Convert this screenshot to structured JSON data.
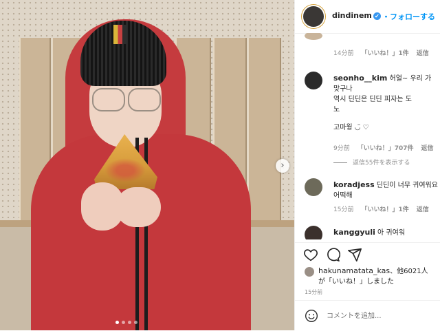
{
  "post": {
    "username": "dindinem",
    "verified_mark": "✔",
    "follow_label": "・フォローする"
  },
  "icons": [
    "verified-icon",
    "heart-icon",
    "comment-icon",
    "share-icon",
    "smile-icon",
    "next-arrow-icon"
  ],
  "comments": [
    {
      "user": "",
      "text": "",
      "time": "14分前",
      "likes": "「いいね！」1件",
      "reply": "返信"
    },
    {
      "user": "seonho__kim",
      "text": " 허얼~ 우리 가\n맞구나 \n역시 딘딘은 딘딘 피자는 도\n노",
      "time": "9分前",
      "likes": "「いいね！」707件",
      "reply": "返信"
    },
    {
      "user": "",
      "text": "고마웡 ◡̈ ♡",
      "time": "",
      "likes": "",
      "reply": ""
    },
    {
      "replies_label": "返信55件を表示する"
    },
    {
      "user": "koradjess",
      "text": " 딘딘이 너무 귀여워요\n어떡해",
      "time": "15分前",
      "likes": "「いいね！」1件",
      "reply": "返信"
    },
    {
      "user": "kanggyuli",
      "text": " 아 귀여워"
    }
  ],
  "likes_text": {
    "user": "hakunamatata_kas",
    "rest": "、他6021人\nが「いいね！」しました"
  },
  "time_ago": "15分前",
  "comment_input": {
    "placeholder": "コメントを追加..."
  },
  "carousel": {
    "next": "›",
    "slides": 4,
    "active": 1
  },
  "colors": {
    "accent": "#0095f6",
    "hoodie": "#c4383c",
    "muted": "#8e8e8e"
  }
}
